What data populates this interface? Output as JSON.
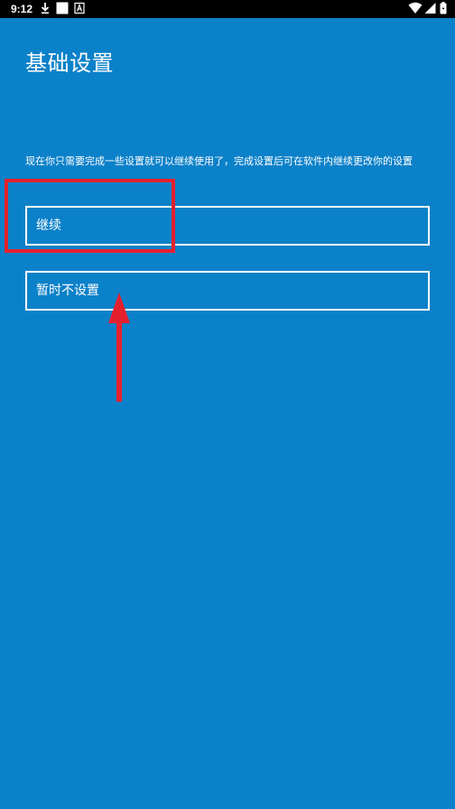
{
  "status_bar": {
    "time": "9:12",
    "icons": [
      "download-icon",
      "square-icon",
      "a-badge-icon",
      "wifi-icon",
      "signal-icon",
      "battery-icon"
    ]
  },
  "page": {
    "title": "基础设置",
    "description": "现在你只需要完成一些设置就可以继续使用了，完成设置后可在软件内继续更改你的设置"
  },
  "buttons": {
    "continue_label": "继续",
    "skip_label": "暂时不设置"
  },
  "annotations": {
    "highlight_color": "#e5202e",
    "arrow_color": "#e5202e"
  },
  "colors": {
    "background": "#0b81c9",
    "text": "#ffffff"
  }
}
